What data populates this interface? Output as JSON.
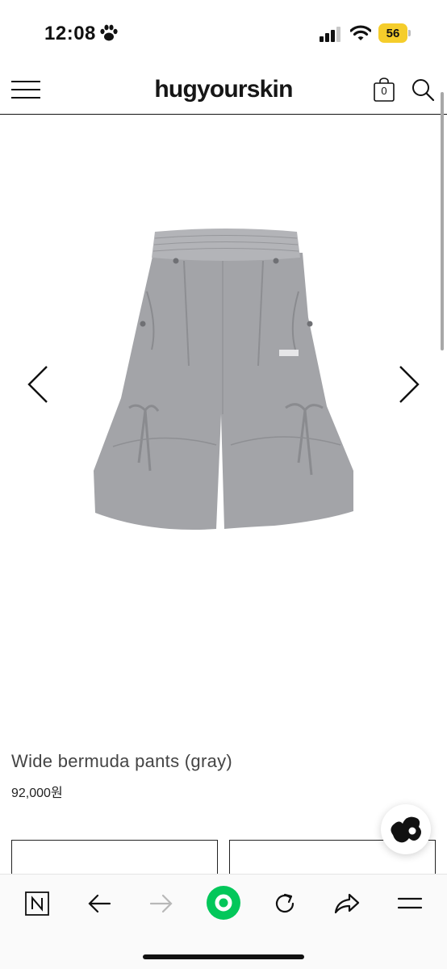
{
  "status_bar": {
    "time": "12:08",
    "battery": "56",
    "icons": [
      "paw-icon",
      "cellular-signal-icon",
      "wifi-icon",
      "battery-icon"
    ],
    "battery_color": "#f5cd2b"
  },
  "header": {
    "brand": "hugyourskin",
    "cart_count": "0",
    "icons": [
      "hamburger-menu-icon",
      "shopping-bag-icon",
      "search-icon"
    ]
  },
  "gallery": {
    "icons": [
      "chevron-left-icon",
      "chevron-right-icon"
    ],
    "product_color": "#a3a4a8"
  },
  "product": {
    "name": "Wide bermuda pants (gray)",
    "price": "92,000원"
  },
  "chat": {
    "icon": "chat-blob-icon"
  },
  "toolbar": {
    "icons": [
      "naver-n-icon",
      "back-arrow-icon",
      "forward-arrow-icon",
      "green-home-icon",
      "reload-icon",
      "share-icon",
      "more-menu-icon"
    ],
    "accent": "#03c75a"
  }
}
